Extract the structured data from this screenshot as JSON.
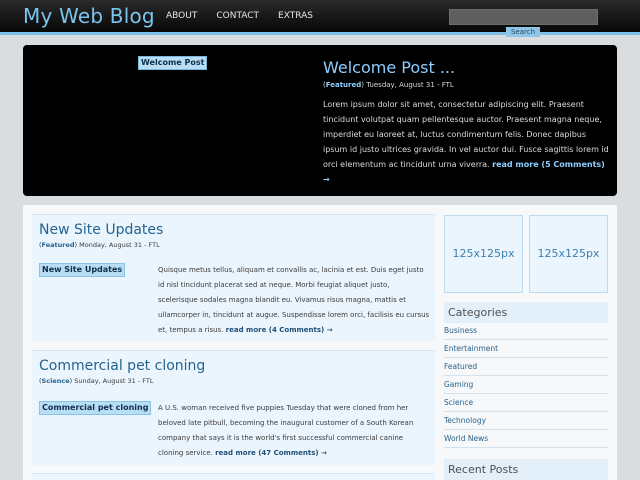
{
  "header": {
    "site_title": "My Web Blog",
    "nav": [
      "ABOUT",
      "CONTACT",
      "EXTRAS"
    ],
    "search": {
      "placeholder": "",
      "button": "Search"
    }
  },
  "featured": {
    "tag": "Welcome Post",
    "title": "Welcome Post ...",
    "meta": {
      "open": "(",
      "category": "Featured",
      "close": ")",
      "date": " Tuesday, August 31 - FTL"
    },
    "body": "Lorem ipsum dolor sit amet, consectetur adipiscing elit. Praesent tincidunt volutpat quam pellentesque auctor. Praesent magna neque, imperdiet eu laoreet at, luctus condimentum felis. Donec dapibus ipsum id justo ultrices gravida. In vel auctor dui. Fusce sagittis lorem id orci elementum ac tincidunt urna viverra. ",
    "more": "read more (5 Comments) →"
  },
  "posts": [
    {
      "title": "New Site Updates",
      "meta": {
        "open": "(",
        "category": "Featured",
        "close": ")",
        "date": " Monday, August 31 - FTL"
      },
      "tag": "New Site Updates",
      "body": "Quisque metus tellus, aliquam et convallis ac, lacinia et est. Duis eget justo id nisl tincidunt placerat sed at neque. Morbi feugiat aliquet justo, scelerisque sodales magna blandit eu. Vivamus risus magna, mattis et ullamcorper in, tincidunt at augue. Suspendisse lorem orci, facilisis eu cursus et, tempus a risus. ",
      "more": "read more (4 Comments) →"
    },
    {
      "title": "Commercial pet cloning",
      "meta": {
        "open": "(",
        "category": "Science",
        "close": ")",
        "date": " Sunday, August 31 - FTL"
      },
      "tag": "Commercial pet cloning",
      "body": "A U.S. woman received five puppies Tuesday that were cloned from her beloved late pitbull, becoming the inaugural customer of a South Korean company that says it is the world's first successful commercial canine cloning service. ",
      "more": "read more (47 Comments) →"
    }
  ],
  "sidebar": {
    "ads": [
      "125x125px",
      "125x125px"
    ],
    "categories_title": "Categories",
    "categories": [
      "Business",
      "Entertainment",
      "Featured",
      "Gaming",
      "Science",
      "Technology",
      "World News"
    ],
    "recent_title": "Recent Posts"
  },
  "colors": {
    "accent": "#7ac4f0",
    "link": "#27638f",
    "tag_bg": "#b8ddf4"
  }
}
